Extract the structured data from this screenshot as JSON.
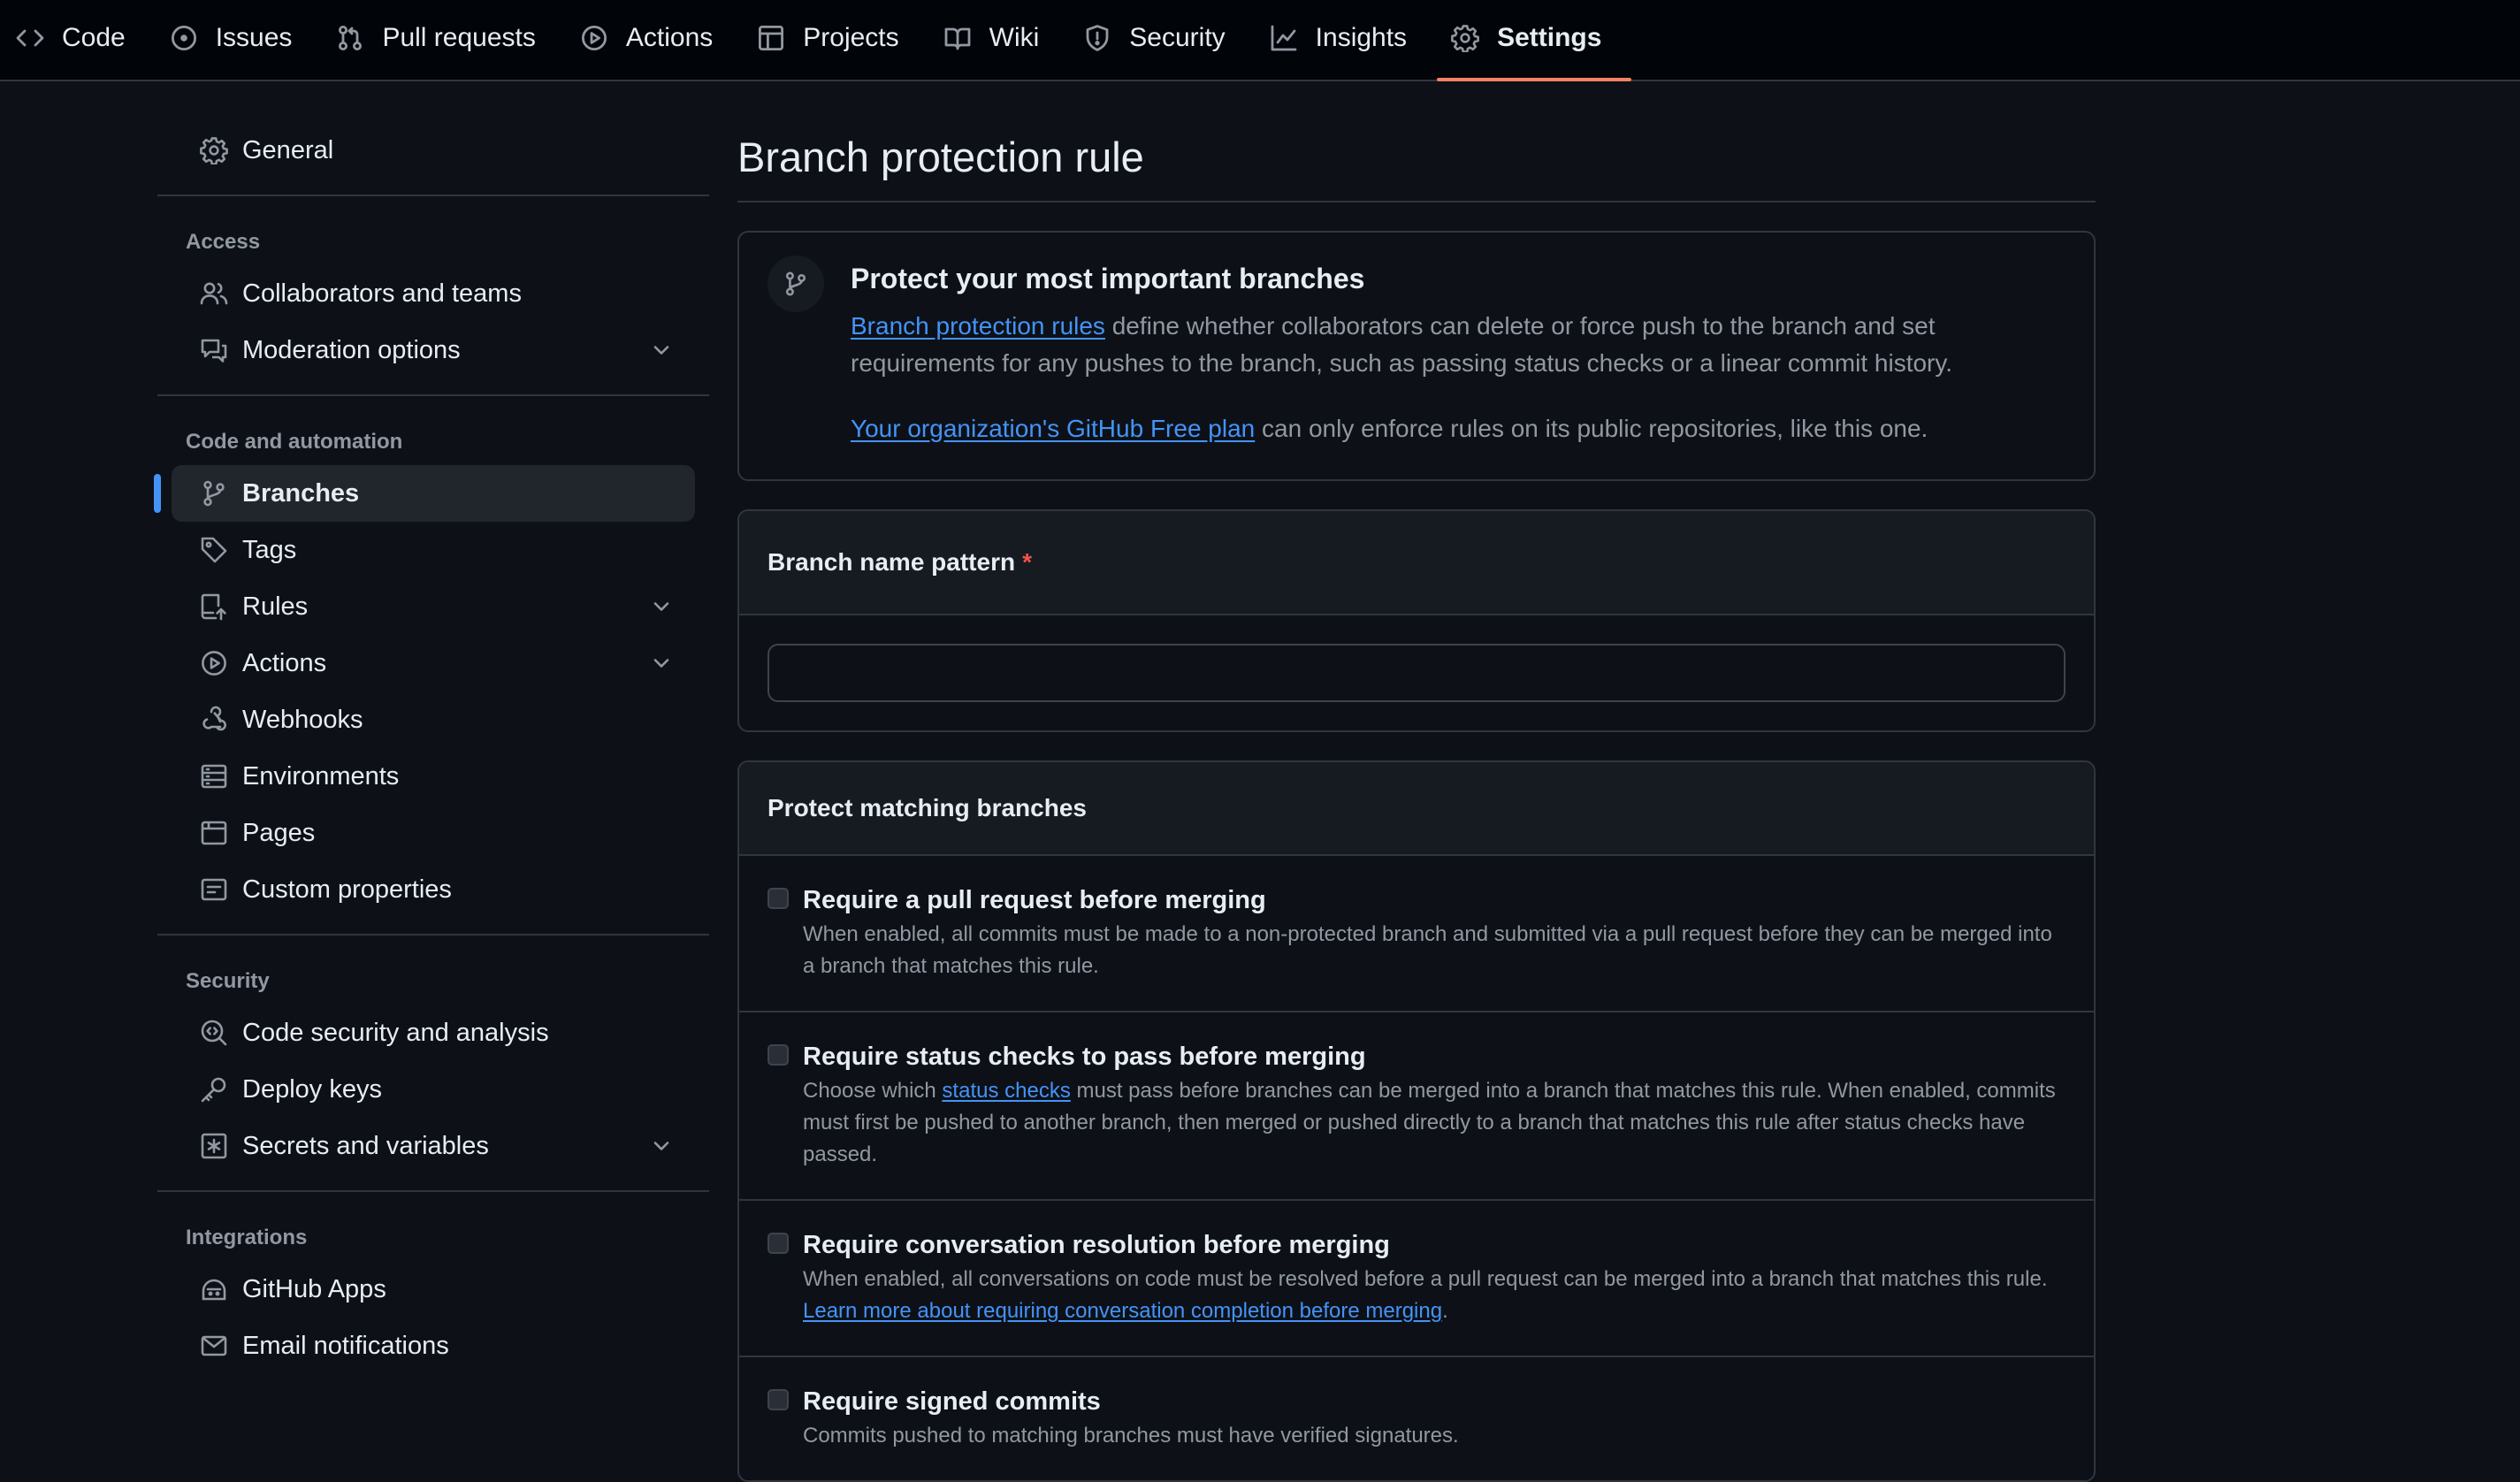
{
  "nav": {
    "tabs": [
      {
        "label": "Code",
        "icon": "code-icon"
      },
      {
        "label": "Issues",
        "icon": "issue-opened-icon"
      },
      {
        "label": "Pull requests",
        "icon": "git-pull-request-icon"
      },
      {
        "label": "Actions",
        "icon": "play-icon"
      },
      {
        "label": "Projects",
        "icon": "table-icon"
      },
      {
        "label": "Wiki",
        "icon": "book-icon"
      },
      {
        "label": "Security",
        "icon": "shield-icon"
      },
      {
        "label": "Insights",
        "icon": "graph-icon"
      },
      {
        "label": "Settings",
        "icon": "gear-icon",
        "active": true
      }
    ]
  },
  "sidebar": {
    "general": "General",
    "access_heading": "Access",
    "access": [
      "Collaborators and teams",
      "Moderation options"
    ],
    "code_heading": "Code and automation",
    "code": [
      "Branches",
      "Tags",
      "Rules",
      "Actions",
      "Webhooks",
      "Environments",
      "Pages",
      "Custom properties"
    ],
    "security_heading": "Security",
    "security": [
      "Code security and analysis",
      "Deploy keys",
      "Secrets and variables"
    ],
    "integrations_heading": "Integrations",
    "integrations": [
      "GitHub Apps",
      "Email notifications"
    ]
  },
  "main": {
    "title": "Branch protection rule",
    "intro": {
      "heading": "Protect your most important branches",
      "link1": "Branch protection rules",
      "text1": " define whether collaborators can delete or force push to the branch and set requirements for any pushes to the branch, such as passing status checks or a linear commit history.",
      "link2": "Your organization's GitHub Free plan",
      "text2": " can only enforce rules on its public repositories, like this one."
    },
    "pattern": {
      "label": "Branch name pattern",
      "required_mark": "*",
      "value": ""
    },
    "protect": {
      "heading": "Protect matching branches",
      "rules": [
        {
          "title": "Require a pull request before merging",
          "desc": "When enabled, all commits must be made to a non-protected branch and submitted via a pull request before they can be merged into a branch that matches this rule."
        },
        {
          "title": "Require status checks to pass before merging",
          "desc_before": "Choose which ",
          "desc_link": "status checks",
          "desc_after": " must pass before branches can be merged into a branch that matches this rule. When enabled, commits must first be pushed to another branch, then merged or pushed directly to a branch that matches this rule after status checks have passed."
        },
        {
          "title": "Require conversation resolution before merging",
          "desc_before": "When enabled, all conversations on code must be resolved before a pull request can be merged into a branch that matches this rule. ",
          "desc_link": "Learn more about requiring conversation completion before merging",
          "desc_after": "."
        },
        {
          "title": "Require signed commits",
          "desc": "Commits pushed to matching branches must have verified signatures."
        }
      ]
    }
  },
  "colors": {
    "accent": "#4493f8",
    "active_tab_underline": "#f78166",
    "required": "#f85149",
    "background": "#0d1117"
  }
}
